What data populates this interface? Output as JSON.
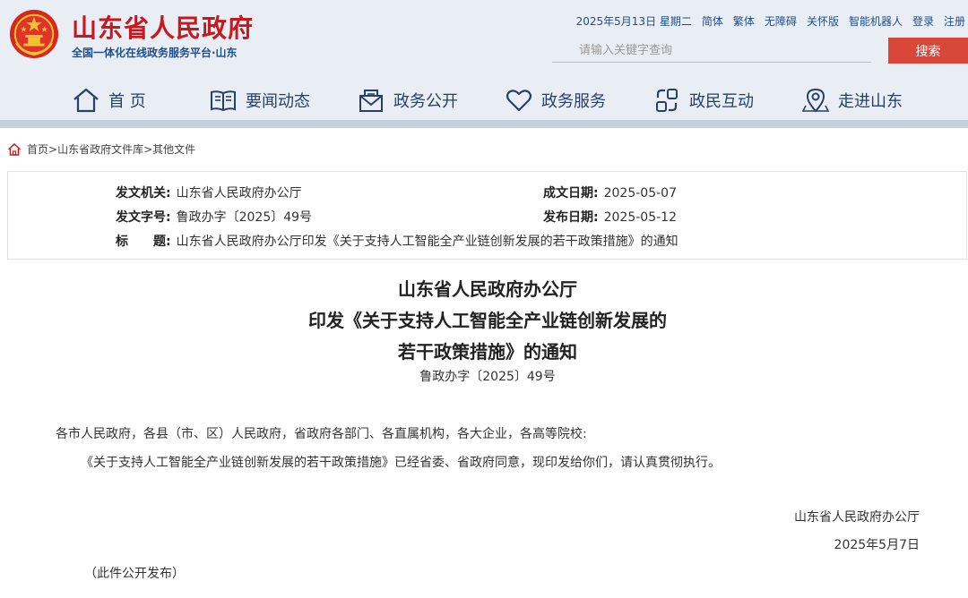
{
  "header": {
    "site_title": "山东省人民政府",
    "site_subtitle": "全国一体化在线政务服务平台·山东",
    "date": "2025年5月13日 星期二",
    "links": [
      "简体",
      "繁体",
      "无障碍",
      "关怀版",
      "智能机器人",
      "登录",
      "注册"
    ],
    "search_placeholder": "请输入关键字查询",
    "search_button": "搜索",
    "colors": {
      "title_red": "#c8181d",
      "nav_blue": "#1f4e8e",
      "search_red": "#d8473a",
      "header_bg": "#e9eef5"
    }
  },
  "nav": [
    {
      "label": "首 页",
      "icon": "home-icon"
    },
    {
      "label": "要闻动态",
      "icon": "book-icon"
    },
    {
      "label": "政务公开",
      "icon": "envelope-icon"
    },
    {
      "label": "政务服务",
      "icon": "heart-icon"
    },
    {
      "label": "政民互动",
      "icon": "exchange-icon"
    },
    {
      "label": "走进山东",
      "icon": "location-icon"
    }
  ],
  "breadcrumb": {
    "icon": "home-icon",
    "items": [
      "首页",
      "山东省政府文件库",
      "其他文件"
    ],
    "separator": ">"
  },
  "meta": {
    "issuer_key": "发文机关:",
    "issuer_val": "山东省人民政府办公厅",
    "doc_no_key": "发文字号:",
    "doc_no_val": "鲁政办字〔2025〕49号",
    "title_key": "标　　题:",
    "title_val": "山东省人民政府办公厅印发《关于支持人工智能全产业链创新发展的若干政策措施》的通知",
    "created_key": "成文日期:",
    "created_val": "2025-05-07",
    "published_key": "发布日期:",
    "published_val": "2025-05-12"
  },
  "article": {
    "title_lines": [
      "山东省人民政府办公厅",
      "印发《关于支持人工智能全产业链创新发展的",
      "若干政策措施》的通知"
    ],
    "doc_number": "鲁政办字〔2025〕49号",
    "salutation": "各市人民政府，各县（市、区）人民政府，省政府各部门、各直属机构，各大企业，各高等院校:",
    "body": "《关于支持人工智能全产业链创新发展的若干政策措施》已经省委、省政府同意，现印发给你们，请认真贯彻执行。",
    "signature": "山东省人民政府办公厅",
    "sign_date": "2025年5月7日",
    "note": "（此件公开发布）"
  }
}
